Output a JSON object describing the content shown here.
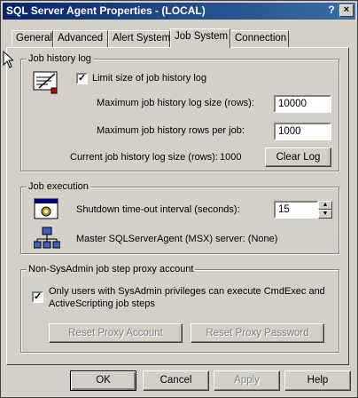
{
  "window": {
    "title": "SQL Server Agent Properties - (LOCAL)",
    "help_glyph": "?",
    "close_glyph": "×"
  },
  "tabs": [
    "General",
    "Advanced",
    "Alert System",
    "Job System",
    "Connection"
  ],
  "active_tab": "Job System",
  "job_history": {
    "group_title": "Job history log",
    "limit_label": "Limit size of job history log",
    "limit_checked": true,
    "max_size_label": "Maximum job history log size (rows):",
    "max_size_value": "10000",
    "max_per_job_label": "Maximum job history rows per job:",
    "max_per_job_value": "1000",
    "current_size_label": "Current job history log size (rows):",
    "current_size_value": "1000",
    "clear_log_button": "Clear Log"
  },
  "job_execution": {
    "group_title": "Job execution",
    "shutdown_label": "Shutdown time-out interval (seconds):",
    "shutdown_value": "15",
    "msx_label": "Master SQLServerAgent (MSX) server: (None)"
  },
  "proxy": {
    "group_title": "Non-SysAdmin job step proxy account",
    "only_sysadmin_label_line1": "Only users with SysAdmin privileges can execute CmdExec and",
    "only_sysadmin_label_line2": "ActiveScripting job steps",
    "only_sysadmin_checked": true,
    "reset_account_button": "Reset Proxy Account",
    "reset_password_button": "Reset Proxy Password"
  },
  "footer": {
    "ok": "OK",
    "cancel": "Cancel",
    "apply": "Apply",
    "help": "Help"
  },
  "colors": {
    "face": "#d4d0c8",
    "title_start": "#0a246a",
    "title_end": "#3a6ea5"
  },
  "icons": [
    "arrow-cursor-icon",
    "job-history-icon",
    "job-execution-icon",
    "msx-server-icon",
    "help-icon",
    "close-icon"
  ]
}
